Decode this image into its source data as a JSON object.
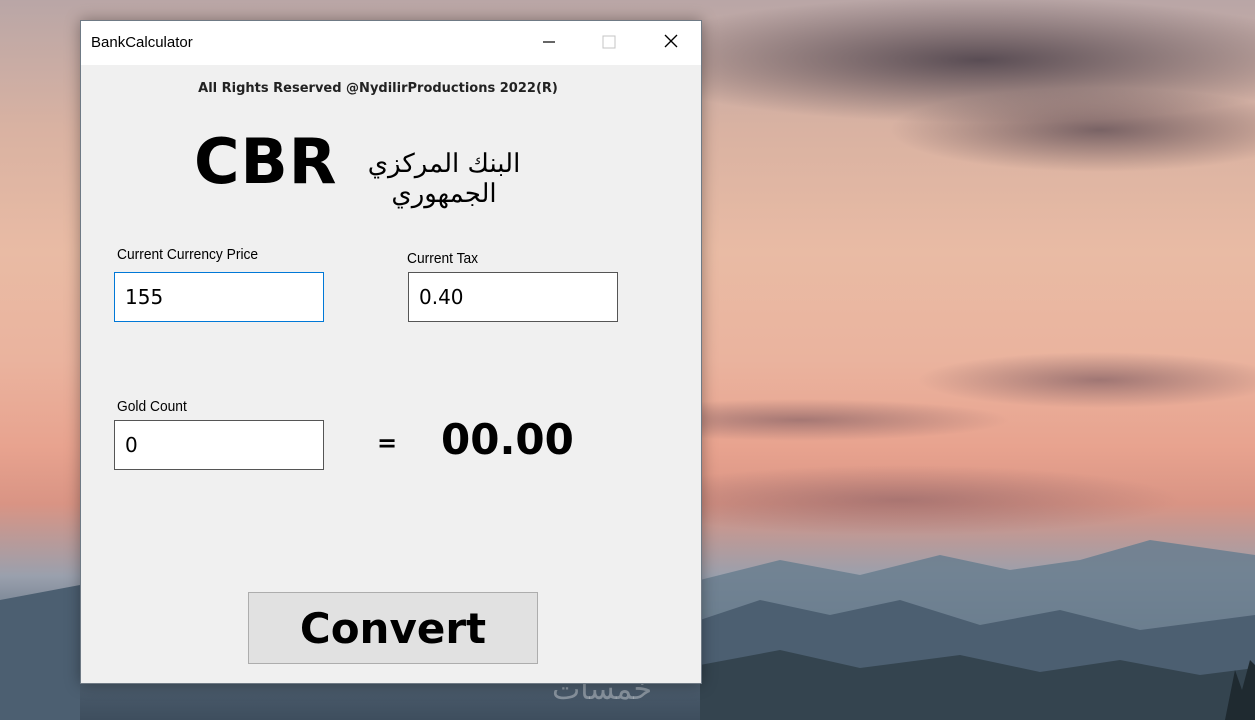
{
  "window": {
    "title": "BankCalculator",
    "controls": {
      "minimize_icon": "minimize-icon",
      "maximize_icon": "maximize-icon",
      "close_icon": "close-icon"
    }
  },
  "header": {
    "copyright": "All Rights Reserved @NydilirProductions 2022(R)",
    "logo_text": "CBR",
    "logo_arabic": "البنك المركزي الجمهوري"
  },
  "form": {
    "currency_price": {
      "label": "Current Currency Price",
      "value": "155"
    },
    "tax": {
      "label": "Current Tax",
      "value": "0.40"
    },
    "gold_count": {
      "label": "Gold Count",
      "value": "0"
    },
    "equals": "=",
    "result": "00.00"
  },
  "actions": {
    "convert_label": "Convert"
  },
  "desktop": {
    "watermark": "خمسات"
  },
  "colors": {
    "window_bg": "#f0f0f0",
    "focus_border": "#0078d7",
    "button_bg": "#e1e1e1"
  }
}
